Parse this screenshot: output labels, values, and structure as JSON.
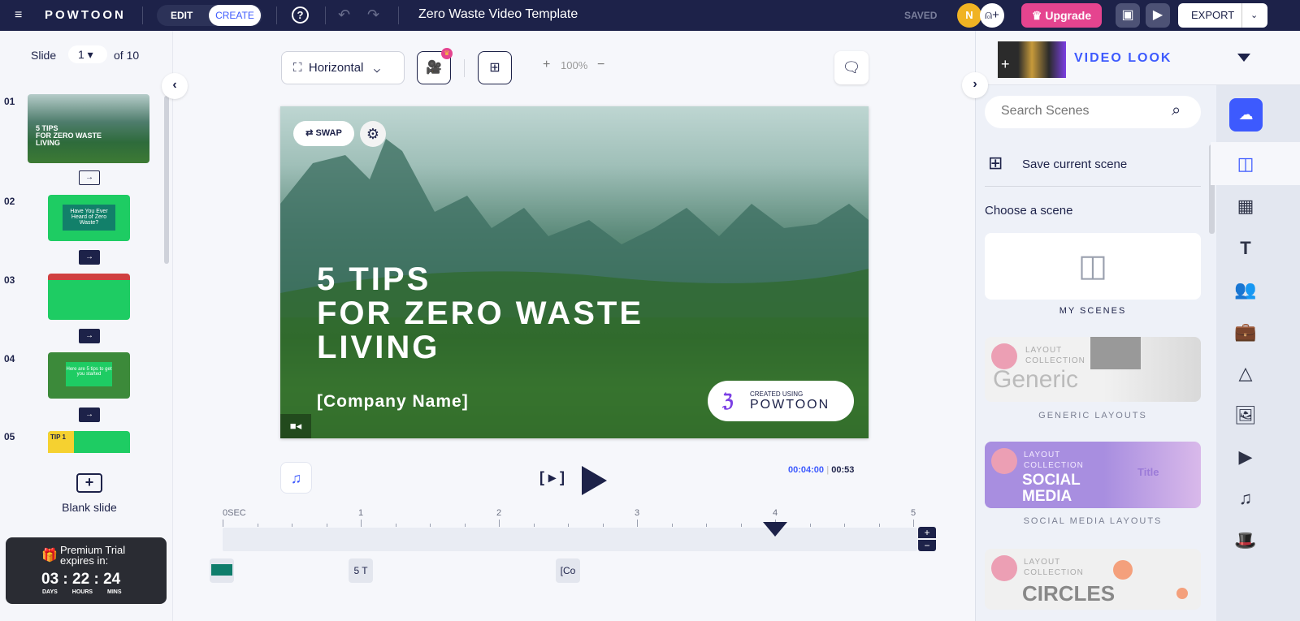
{
  "topbar": {
    "logo": "POWTOON",
    "edit": "EDIT",
    "create": "CREATE",
    "title": "Zero Waste Video Template",
    "saved": "SAVED",
    "avatar_initial": "N",
    "upgrade": "Upgrade",
    "export": "EXPORT"
  },
  "left": {
    "slide_label": "Slide",
    "slide_current": "1",
    "slide_of": "of 10",
    "slides": [
      {
        "num": "01",
        "title": "5 TIPS\nFOR ZERO WASTE\nLIVING",
        "sub": "[Company Name]"
      },
      {
        "num": "02",
        "title": "Have You Ever Heard of Zero Waste?"
      },
      {
        "num": "03"
      },
      {
        "num": "04",
        "title": "Here are 5 tips to get you started"
      },
      {
        "num": "05",
        "title": "TIP 1"
      }
    ],
    "blank_slide": "Blank slide",
    "trial": {
      "title": "Premium Trial expires in:",
      "days": "03",
      "hours": "22",
      "mins": "24",
      "days_label": "DAYS",
      "hours_label": "HOURS",
      "mins_label": "MINS"
    }
  },
  "toolbar": {
    "orientation": "Horizontal",
    "zoom": "100%",
    "plus": "+",
    "minus": "−"
  },
  "canvas": {
    "swap": "SWAP",
    "title_line1": "5 TIPS",
    "title_line2": "FOR ZERO WASTE",
    "title_line3": "LIVING",
    "company": "[Company Name]",
    "badge_small": "CREATED USING",
    "badge_brand": "POWTOON"
  },
  "playback": {
    "current_time": "00:04:00",
    "duration": "00:53"
  },
  "timeline": {
    "ticks": [
      "0SEC",
      "1",
      "2",
      "3",
      "4",
      "5"
    ],
    "playhead_sec": 4,
    "max_sec": 5,
    "items": [
      {
        "label": "5 T",
        "sec": 1
      },
      {
        "label": "[Co",
        "sec": 2.5
      }
    ]
  },
  "right": {
    "video_look": "VIDEO LOOK",
    "search_placeholder": "Search Scenes",
    "save_scene": "Save current scene",
    "choose": "Choose a scene",
    "my_scenes": "MY SCENES",
    "collections": [
      {
        "small": "LAYOUT\nCOLLECTION",
        "big": "Generic",
        "label": "GENERIC LAYOUTS"
      },
      {
        "small": "LAYOUT\nCOLLECTION",
        "big": "SOCIAL\nMEDIA",
        "label": "SOCIAL MEDIA LAYOUTS",
        "inner": "Title"
      },
      {
        "small": "LAYOUT\nCOLLECTION",
        "big": "CIRCLES"
      }
    ]
  },
  "colors": {
    "nav": "#1d2249",
    "accent": "#3d5afe",
    "upgrade": "#e5448f",
    "avatar": "#f0b323"
  }
}
